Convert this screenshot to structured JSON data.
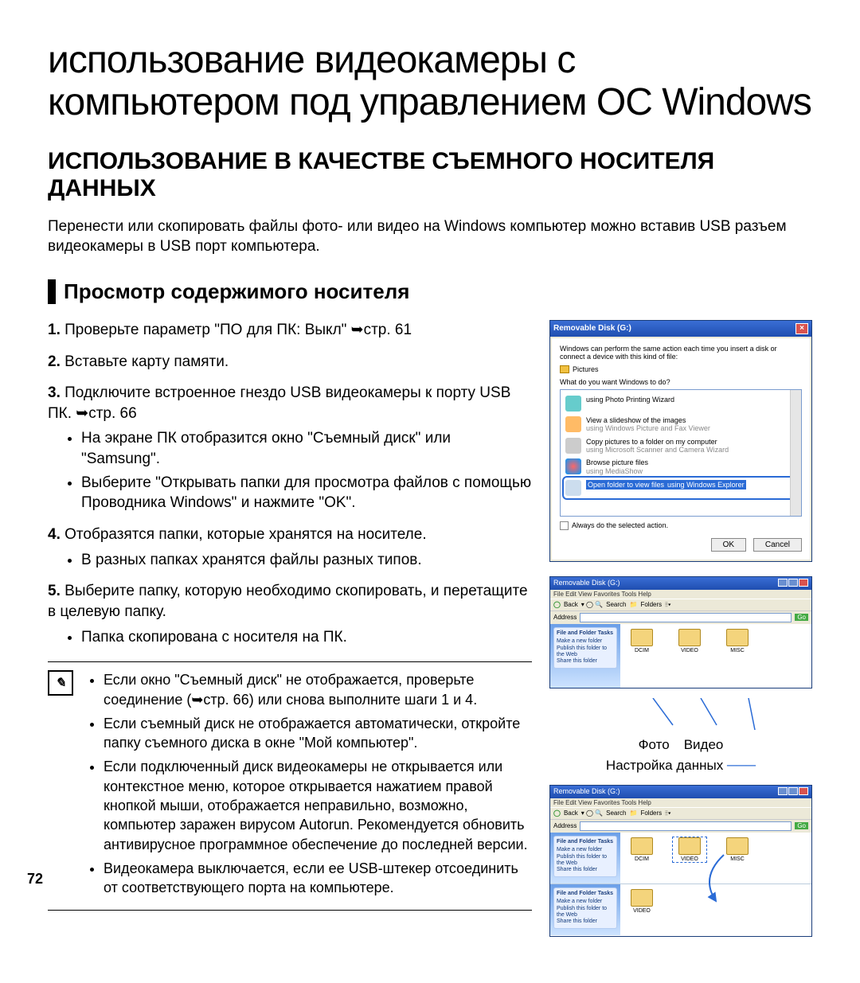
{
  "page": {
    "title": "использование видеокамеры с компьютером под управлением ОС Windows",
    "section_title": "ИСПОЛЬЗОВАНИЕ В КАЧЕСТВЕ СЪЕМНОГО НОСИТЕЛЯ ДАННЫХ",
    "intro": "Перенести или скопировать файлы фото- или видео на Windows компьютер можно вставив USB разъем видеокамеры в USB порт компьютера.",
    "sub_heading": "Просмотр содержимого носителя",
    "page_number": "72"
  },
  "steps": [
    {
      "num": "1.",
      "text": "Проверьте параметр \"ПО для ПК: Выкл\" ➥стр.  61",
      "bullets": []
    },
    {
      "num": "2.",
      "text": "Вставьте карту памяти.",
      "bullets": []
    },
    {
      "num": "3.",
      "text": "Подключите встроенное гнездо USB видеокамеры к порту USB ПК. ➥стр. 66",
      "bullets": [
        "На экране ПК отобразится окно \"Съемный диск\" или \"Samsung\".",
        "Выберите \"Открывать папки для просмотра файлов с помощью Проводника Windows\" и нажмите \"OK\"."
      ]
    },
    {
      "num": "4.",
      "text": "Отобразятся папки, которые хранятся на носителе.",
      "bullets": [
        "В разных папках хранятся файлы разных типов."
      ]
    },
    {
      "num": "5.",
      "text": "Выберите папку, которую необходимо скопировать, и перетащите в целевую папку.",
      "bullets": [
        "Папка скопирована с носителя на ПК."
      ]
    }
  ],
  "notes": [
    "Если окно \"Съемный диск\" не отображается, проверьте соединение (➥стр. 66) или снова выполните шаги 1 и 4.",
    "Если съемный диск не отображается автоматически, откройте папку съемного диска в окне \"Мой компьютер\".",
    "Если подключенный диск видеокамеры не открывается или контекстное меню, которое открывается нажатием правой кнопкой мыши, отображается неправильно, возможно, компьютер заражен вирусом Autorun. Рекомендуется обновить антивирусное программное обеспечение до последней версии.",
    "Видеокамера выключается, если ее USB-штекер отсоединить от соответствующего порта на компьютере."
  ],
  "dialog": {
    "title": "Removable Disk (G:)",
    "prompt": "Windows can perform the same action each time you insert a disk or connect a device with this kind of file:",
    "file_label": "Pictures",
    "question": "What do you want Windows to do?",
    "items": [
      {
        "main": "using Photo Printing Wizard",
        "sub": ""
      },
      {
        "main": "View a slideshow of the images",
        "sub": "using Windows Picture and Fax Viewer"
      },
      {
        "main": "Copy pictures to a folder on my computer",
        "sub": "using Microsoft Scanner and Camera Wizard"
      },
      {
        "main": "Browse picture files",
        "sub": "using MediaShow"
      },
      {
        "main": "Open folder to view files",
        "sub": "using Windows Explorer",
        "selected": true
      }
    ],
    "checkbox": "Always do the selected action.",
    "ok": "OK",
    "cancel": "Cancel"
  },
  "explorer1": {
    "title": "Removable Disk (G:)",
    "menu": "File  Edit  View  Favorites  Tools  Help",
    "back": "Back",
    "search": "Search",
    "folders_btn": "Folders",
    "address_label": "Address",
    "go": "Go",
    "side_heading": "File and Folder Tasks",
    "side_items": [
      "Make a new folder",
      "Publish this folder to the Web",
      "Share this folder"
    ],
    "folders": [
      "DCIM",
      "VIDEO",
      "MISC"
    ]
  },
  "explorer2": {
    "title": "Removable Disk (G:)",
    "side_heading1": "File and Folder Tasks",
    "side_heading2": "File and Folder Tasks",
    "side_items1": [
      "Make a new folder",
      "Publish this folder to the Web",
      "Share this folder"
    ],
    "side_items2": [
      "Make a new folder",
      "Publish this folder to the Web",
      "Share this folder"
    ],
    "folders_top": [
      "DCIM",
      "VIDEO",
      "MISC"
    ],
    "folders_bottom": [
      "VIDEO"
    ]
  },
  "callouts": {
    "photo": "Фото",
    "video": "Видео",
    "settings": "Настройка данных"
  }
}
